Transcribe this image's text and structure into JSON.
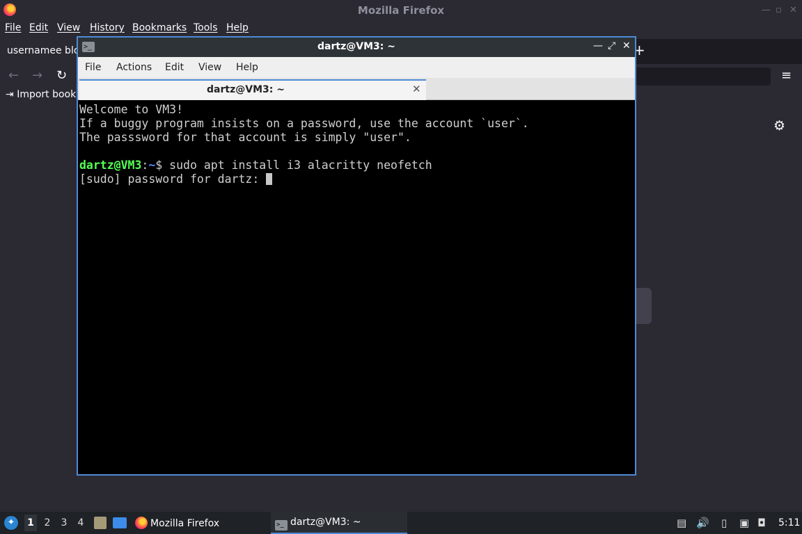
{
  "firefox": {
    "window_title": "Mozilla Firefox",
    "menus": [
      "File",
      "Edit",
      "View",
      "History",
      "Bookmarks",
      "Tools",
      "Help"
    ],
    "tab_label": "usernamee blo",
    "bookmark_import": "Import bookı"
  },
  "terminal": {
    "window_title": "dartz@VM3: ~",
    "menus": [
      "File",
      "Actions",
      "Edit",
      "View",
      "Help"
    ],
    "tab_label": "dartz@VM3: ~",
    "lines": [
      "Welcome to VM3!",
      "If a buggy program insists on a password, use the account `user`.",
      "The passsword for that account is simply \"user\"."
    ],
    "prompt": {
      "user_host": "dartz@VM3",
      "sep": ":",
      "path": "~",
      "symbol": "$ ",
      "command": "sudo apt install i3 alacritty neofetch"
    },
    "sudo_prompt": "[sudo] password for dartz: "
  },
  "taskbar": {
    "workspaces": [
      "1",
      "2",
      "3",
      "4"
    ],
    "active_workspace": "1",
    "tasks": [
      "Mozilla Firefox",
      "dartz@VM3: ~"
    ],
    "clock": "5:11"
  },
  "colors": {
    "accent": "#4f8ad6",
    "prompt_user": "#54ff54",
    "prompt_path": "#5c8cff"
  }
}
